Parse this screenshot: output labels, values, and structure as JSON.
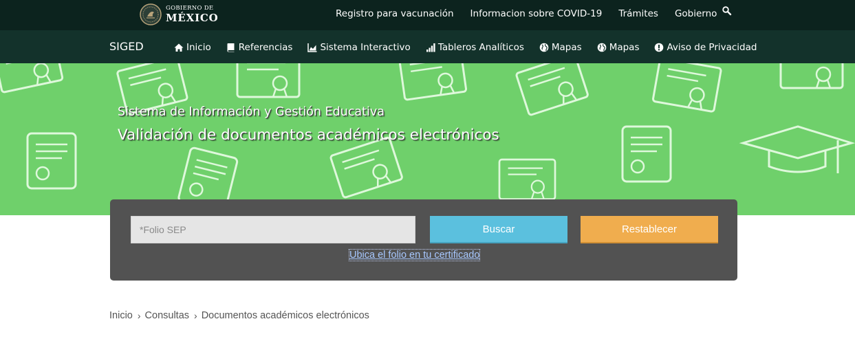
{
  "gov_bar": {
    "logo": {
      "line1": "GOBIERNO DE",
      "line2": "MÉXICO"
    },
    "links": [
      "Registro para vacunación",
      "Informacion sobre COVID-19",
      "Trámites",
      "Gobierno"
    ],
    "search_icon": "search-icon"
  },
  "sub_nav": {
    "brand": "SIGED",
    "items": [
      {
        "label": "Inicio",
        "icon": "home-icon"
      },
      {
        "label": "Referencias",
        "icon": "book-icon"
      },
      {
        "label": "Sistema Interactivo",
        "icon": "area-chart-icon"
      },
      {
        "label": "Tableros Analíticos",
        "icon": "signal-bars-icon"
      },
      {
        "label": "Mapas",
        "icon": "globe-icon"
      },
      {
        "label": "Mapas",
        "icon": "globe-icon"
      },
      {
        "label": "Aviso de Privacidad",
        "icon": "exclamation-circle-icon"
      }
    ]
  },
  "hero": {
    "subtitle": "Sistema de Información y Gestión Educativa",
    "title": "Validación de documentos académicos electrónicos"
  },
  "search": {
    "placeholder": "*Folio SEP",
    "value": "",
    "search_button": "Buscar",
    "reset_button": "Restablecer",
    "help_link": "Ubica el folio en tu certificado"
  },
  "breadcrumb": [
    "Inicio",
    "Consultas",
    "Documentos académicos electrónicos"
  ],
  "colors": {
    "gov_bar": "#0c231e",
    "sub_nav": "#13322b",
    "hero_green": "#6fd06b",
    "panel": "#525252",
    "search_button": "#5bc0de",
    "reset_button": "#f0ad4e"
  }
}
